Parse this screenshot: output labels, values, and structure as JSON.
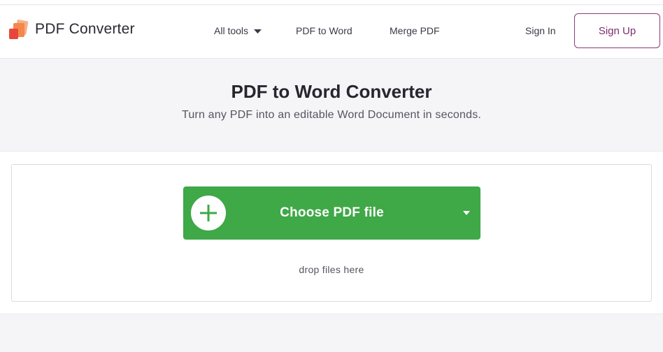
{
  "brand": {
    "name": "PDF Converter"
  },
  "nav": {
    "all_tools": "All tools",
    "pdf_to_word": "PDF to Word",
    "merge_pdf": "Merge PDF"
  },
  "auth": {
    "sign_in": "Sign In",
    "sign_up": "Sign Up"
  },
  "hero": {
    "title": "PDF to Word Converter",
    "subtitle": "Turn any PDF into an editable Word Document in seconds."
  },
  "upload": {
    "choose_label": "Choose PDF file",
    "drop_hint": "drop files here"
  },
  "colors": {
    "accent_green": "#3fa847",
    "signup_border": "#8a3a7a",
    "logo_orange": "#f2894a",
    "logo_red": "#e8453c"
  },
  "icons": {
    "logo": "stacked-pages-logo-icon",
    "all_tools_caret": "chevron-down-icon",
    "choose_plus": "plus-circle-icon",
    "choose_dropdown": "caret-down-icon"
  }
}
